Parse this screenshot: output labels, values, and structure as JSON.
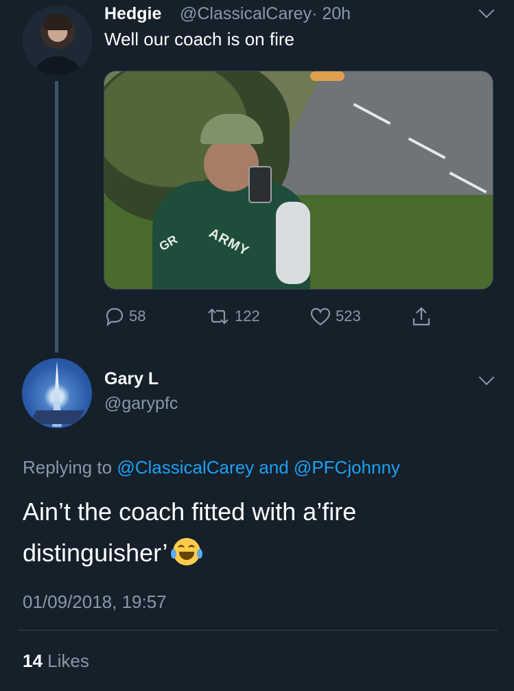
{
  "original_tweet": {
    "author_name": "Hedgie",
    "author_handle": "@ClassicalCarey",
    "time": "· 20h",
    "text": "Well our coach is on fire",
    "media_text": {
      "jersey_army": "ARMY",
      "jersey_left": "GR"
    },
    "actions": {
      "replies": "58",
      "retweets": "122",
      "likes": "523"
    }
  },
  "reply_tweet": {
    "author_name": "Gary L",
    "author_handle": "@garypfc",
    "replying_prefix": "Replying to ",
    "replying_user1": "@ClassicalCarey",
    "replying_and": " and ",
    "replying_user2": "@PFCjohnny",
    "text": "Ain’t the coach fitted with a’fire distinguisher’",
    "emoji": "face-with-tears-of-joy",
    "timestamp": "01/09/2018, 19:57",
    "likes_count": "14",
    "likes_label": "Likes"
  },
  "colors": {
    "background": "#15202b",
    "secondary_text": "#8899a6",
    "link": "#1da1f2",
    "divider": "#38444d"
  },
  "icons": {
    "reply": "reply-icon",
    "retweet": "retweet-icon",
    "like": "heart-icon",
    "share": "share-icon",
    "more": "chevron-down-icon"
  }
}
